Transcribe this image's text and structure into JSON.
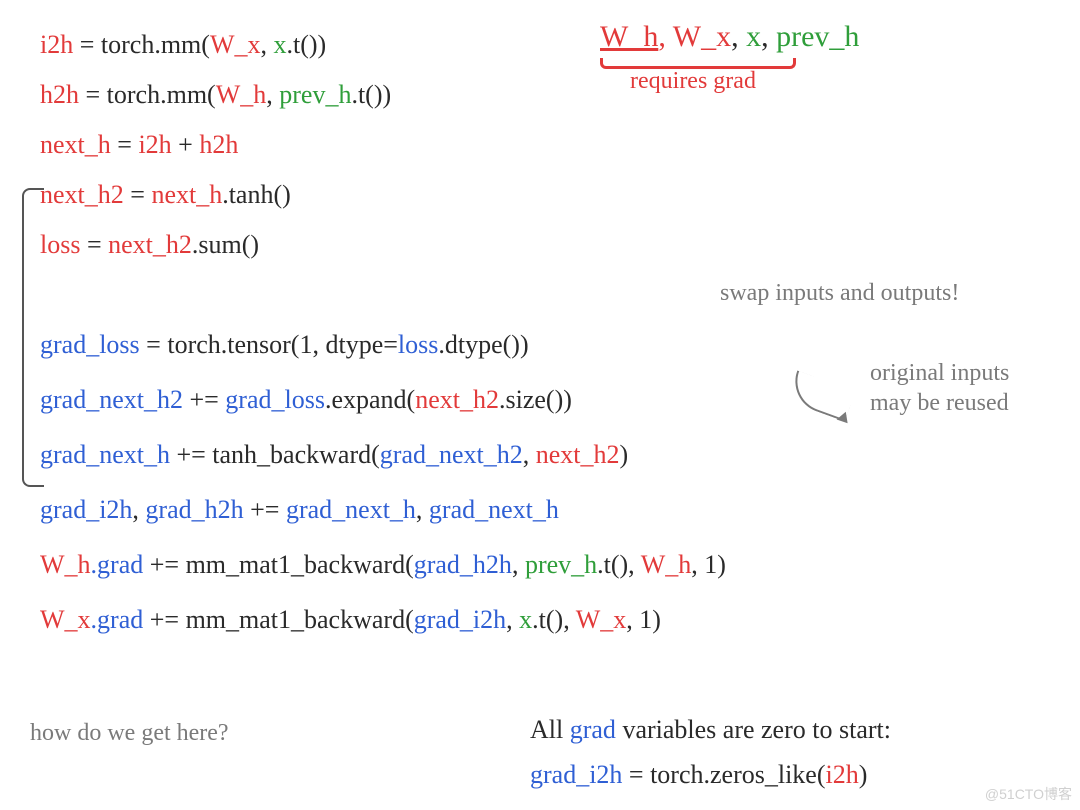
{
  "header": {
    "wh": "W_h",
    "wx": "W_x",
    "x": "x",
    "prevh": "prev_h",
    "req": "requires grad"
  },
  "l1": {
    "lhs": "i2h",
    "eq": " = ",
    "fn": "torch.mm(",
    "a": "W_x",
    "c1": ", ",
    "b": "x",
    "tail": ".t())"
  },
  "l2": {
    "lhs": "h2h",
    "eq": " = ",
    "fn": "torch.mm(",
    "a": "W_h",
    "c1": ", ",
    "b": "prev_h",
    "tail": ".t())"
  },
  "l3": {
    "lhs": "next_h",
    "eq": " = ",
    "a": "i2h",
    "plus": " + ",
    "b": "h2h"
  },
  "l4": {
    "lhs": "next_h2",
    "eq": " = ",
    "a": "next_h",
    "tail": ".tanh()"
  },
  "l5": {
    "lhs": "loss",
    "eq": " = ",
    "a": "next_h2",
    "tail": ".sum()"
  },
  "ann1": "swap inputs and outputs!",
  "l6": {
    "lhs": "grad_loss",
    "eq": " = ",
    "fn": "torch.tensor(1, dtype=",
    "a": "loss",
    "tail": ".dtype())"
  },
  "l7": {
    "lhs": "grad_next_h2",
    "eq": " += ",
    "a": "grad_loss",
    "mid": ".expand(",
    "b": "next_h2",
    "tail": ".size())"
  },
  "ann2a": "original inputs",
  "ann2b": "may be reused",
  "l8": {
    "lhs": "grad_next_h",
    "eq": " += ",
    "fn": "tanh_backward(",
    "a": "grad_next_h2",
    "c1": ", ",
    "b": "next_h2",
    "tail": ")"
  },
  "l9": {
    "a": "grad_i2h",
    "c1": ", ",
    "b": "grad_h2h",
    "eq": " += ",
    "c": "grad_next_h",
    "c2": ", ",
    "d": "grad_next_h"
  },
  "l10": {
    "a": "W_h",
    "grad": ".grad",
    "eq": " += ",
    "fn": "mm_mat1_backward(",
    "b": "grad_h2h",
    "c1": ", ",
    "c": "prev_h",
    "mid": ".t(), ",
    "d": "W_h",
    "tail": ", 1)"
  },
  "l11": {
    "a": "W_x",
    "grad": ".grad",
    "eq": " += ",
    "fn": "mm_mat1_backward(",
    "b": "grad_i2h",
    "c1": ", ",
    "c": "x",
    "mid": ".t(), ",
    "d": "W_x",
    "tail": ", 1)"
  },
  "foot1": "how do we get here?",
  "foot2a": "All ",
  "foot2b": "grad",
  "foot2c": " variables are zero to start:",
  "foot3a": "grad_i2h",
  "foot3b": " = torch.zeros_like(",
  "foot3c": "i2h",
  "foot3d": ")",
  "watermark": "@51CTO博客"
}
